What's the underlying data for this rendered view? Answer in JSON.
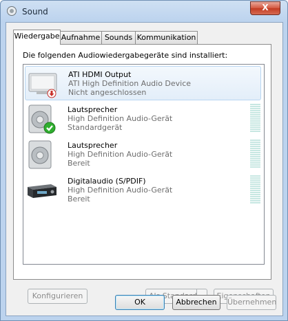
{
  "window": {
    "title": "Sound",
    "close_label": "X"
  },
  "tabs": [
    {
      "label": "Wiedergabe",
      "active": true
    },
    {
      "label": "Aufnahme",
      "active": false
    },
    {
      "label": "Sounds",
      "active": false
    },
    {
      "label": "Kommunikation",
      "active": false
    }
  ],
  "panel": {
    "label": "Die folgenden Audiowiedergabegeräte sind installiert:"
  },
  "devices": [
    {
      "name": "ATI HDMI Output",
      "driver": "ATI High Definition Audio Device",
      "status": "Nicht angeschlossen",
      "icon": "hdmi-monitor-icon",
      "badge": "disconnected-badge",
      "selected": true
    },
    {
      "name": "Lautsprecher",
      "driver": "High Definition Audio-Gerät",
      "status": "Standardgerät",
      "icon": "speaker-icon",
      "badge": "default-check-badge",
      "selected": false
    },
    {
      "name": "Lautsprecher",
      "driver": "High Definition Audio-Gerät",
      "status": "Bereit",
      "icon": "speaker-icon",
      "badge": "",
      "selected": false
    },
    {
      "name": "Digitalaudio (S/PDIF)",
      "driver": "High Definition Audio-Gerät",
      "status": "Bereit",
      "icon": "digital-receiver-icon",
      "badge": "",
      "selected": false
    }
  ],
  "buttons": {
    "configure": "Konfigurieren",
    "set_default": "Als Standard",
    "properties": "Eigenschaften",
    "ok": "OK",
    "cancel": "Abbrechen",
    "apply": "Übernehmen"
  },
  "colors": {
    "selection": "#e3eef9",
    "meter": "#c7e7e2",
    "check": "#2fae2f",
    "disconnected": "#c8302a"
  }
}
